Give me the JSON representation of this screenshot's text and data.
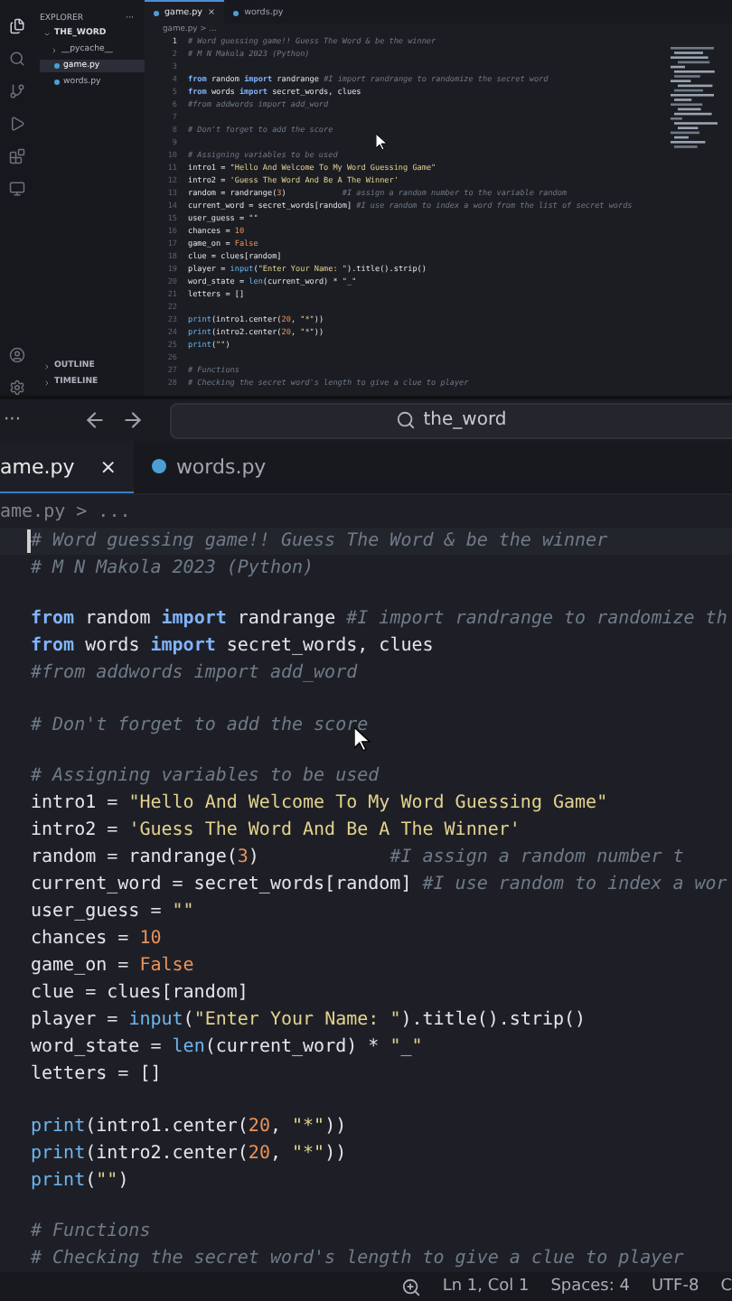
{
  "mini_window": {
    "sidebar": {
      "title": "EXPLORER",
      "more": "···",
      "folder": "THE_WORD",
      "items": [
        {
          "label": "__pycache__",
          "kind": "folder",
          "selected": false
        },
        {
          "label": "game.py",
          "kind": "file",
          "selected": true
        },
        {
          "label": "words.py",
          "kind": "file",
          "selected": false
        }
      ],
      "panels": [
        "OUTLINE",
        "TIMELINE"
      ]
    },
    "tabs": [
      {
        "label": "game.py",
        "selected": true,
        "close": "×"
      },
      {
        "label": "words.py",
        "selected": false
      }
    ],
    "breadcrumb": "game.py > ...",
    "lines": [
      {
        "number": "1",
        "tokens": [
          {
            "kind": "cmt",
            "text": "# Word guessing game!! Guess The Word & be the winner"
          }
        ]
      },
      {
        "number": "2",
        "tokens": [
          {
            "kind": "cmt",
            "text": "# M N Makola 2023 (Python)"
          }
        ]
      },
      {
        "number": "3"
      },
      {
        "number": "4",
        "tokens": [
          {
            "kind": "kw",
            "text": "from"
          },
          {
            "kind": "txt",
            "text": " random "
          },
          {
            "kind": "kw",
            "text": "import"
          },
          {
            "kind": "txt",
            "text": " randrange "
          },
          {
            "kind": "cmt",
            "text": "#I import randrange to randomize the secret word"
          }
        ]
      },
      {
        "number": "5",
        "tokens": [
          {
            "kind": "kw",
            "text": "from"
          },
          {
            "kind": "txt",
            "text": " words "
          },
          {
            "kind": "kw",
            "text": "import"
          },
          {
            "kind": "txt",
            "text": " secret_words, clues"
          }
        ]
      },
      {
        "number": "6",
        "tokens": [
          {
            "kind": "cmt",
            "text": "#from addwords import add_word"
          }
        ]
      },
      {
        "number": "7"
      },
      {
        "number": "8",
        "tokens": [
          {
            "kind": "cmt",
            "text": "# Don't forget to add the score"
          }
        ]
      },
      {
        "number": "9"
      },
      {
        "number": "10",
        "tokens": [
          {
            "kind": "cmt",
            "text": "# Assigning variables to be used"
          }
        ]
      },
      {
        "number": "11",
        "tokens": [
          {
            "kind": "txt",
            "text": "intro1 = "
          },
          {
            "kind": "str",
            "text": "\"Hello And Welcome To My Word Guessing Game\""
          }
        ]
      },
      {
        "number": "12",
        "tokens": [
          {
            "kind": "txt",
            "text": "intro2 = "
          },
          {
            "kind": "str",
            "text": "'Guess The Word And Be A The Winner'"
          }
        ]
      },
      {
        "number": "13",
        "tokens": [
          {
            "kind": "txt",
            "text": "random = randrange("
          },
          {
            "kind": "num",
            "text": "3"
          },
          {
            "kind": "txt",
            "text": ")            "
          },
          {
            "kind": "cmt",
            "text": "#I assign a random number to the variable random"
          }
        ]
      },
      {
        "number": "14",
        "tokens": [
          {
            "kind": "txt",
            "text": "current_word = secret_words[random] "
          },
          {
            "kind": "cmt",
            "text": "#I use random to index a word from the list of secret words"
          }
        ]
      },
      {
        "number": "15",
        "tokens": [
          {
            "kind": "txt",
            "text": "user_guess = "
          },
          {
            "kind": "str",
            "text": "\"\""
          }
        ]
      },
      {
        "number": "16",
        "tokens": [
          {
            "kind": "txt",
            "text": "chances = "
          },
          {
            "kind": "num",
            "text": "10"
          }
        ]
      },
      {
        "number": "17",
        "tokens": [
          {
            "kind": "txt",
            "text": "game_on = "
          },
          {
            "kind": "num",
            "text": "False"
          }
        ]
      },
      {
        "number": "18",
        "tokens": [
          {
            "kind": "txt",
            "text": "clue = clues[random]"
          }
        ]
      },
      {
        "number": "19",
        "tokens": [
          {
            "kind": "txt",
            "text": "player = "
          },
          {
            "kind": "fn",
            "text": "input"
          },
          {
            "kind": "txt",
            "text": "("
          },
          {
            "kind": "str",
            "text": "\"Enter Your Name: \""
          },
          {
            "kind": "txt",
            "text": ").title().strip()"
          }
        ]
      },
      {
        "number": "20",
        "tokens": [
          {
            "kind": "txt",
            "text": "word_state = "
          },
          {
            "kind": "fn",
            "text": "len"
          },
          {
            "kind": "txt",
            "text": "(current_word) * "
          },
          {
            "kind": "str",
            "text": "\"_\""
          }
        ]
      },
      {
        "number": "21",
        "tokens": [
          {
            "kind": "txt",
            "text": "letters = []"
          }
        ]
      },
      {
        "number": "22"
      },
      {
        "number": "23",
        "tokens": [
          {
            "kind": "fn",
            "text": "print"
          },
          {
            "kind": "txt",
            "text": "(intro1.center("
          },
          {
            "kind": "num",
            "text": "20"
          },
          {
            "kind": "txt",
            "text": ", "
          },
          {
            "kind": "str",
            "text": "\"*\""
          },
          {
            "kind": "txt",
            "text": "))"
          }
        ]
      },
      {
        "number": "24",
        "tokens": [
          {
            "kind": "fn",
            "text": "print"
          },
          {
            "kind": "txt",
            "text": "(intro2.center("
          },
          {
            "kind": "num",
            "text": "20"
          },
          {
            "kind": "txt",
            "text": ", "
          },
          {
            "kind": "str",
            "text": "\"*\""
          },
          {
            "kind": "txt",
            "text": "))"
          }
        ]
      },
      {
        "number": "25",
        "tokens": [
          {
            "kind": "fn",
            "text": "print"
          },
          {
            "kind": "txt",
            "text": "("
          },
          {
            "kind": "str",
            "text": "\"\""
          },
          {
            "kind": "txt",
            "text": ")"
          }
        ]
      },
      {
        "number": "26"
      },
      {
        "number": "27",
        "tokens": [
          {
            "kind": "cmt",
            "text": "# Functions"
          }
        ]
      },
      {
        "number": "28",
        "tokens": [
          {
            "kind": "cmt",
            "text": "# Checking the secret word's length to give a clue to player"
          }
        ]
      }
    ]
  },
  "title_bar": {
    "more": "···",
    "search": "the_word"
  },
  "tabs": [
    {
      "label": "ame.py",
      "selected": true,
      "close": "×"
    },
    {
      "label": "words.py",
      "selected": false
    }
  ],
  "breadcrumb": "ame.py > ...",
  "lines": [
    [
      {
        "kind": "cmt",
        "text": "# Word guessing game!! Guess The Word & be the winner"
      }
    ],
    [
      {
        "kind": "cmt",
        "text": "# M N Makola 2023 (Python)"
      }
    ],
    {
      "kind": "blank"
    },
    [
      {
        "kind": "kw",
        "text": "from"
      },
      {
        "kind": "txt",
        "text": " random "
      },
      {
        "kind": "kw",
        "text": "import"
      },
      {
        "kind": "txt",
        "text": " randrange "
      },
      {
        "kind": "cmt",
        "text": "#I import randrange to randomize th"
      }
    ],
    [
      {
        "kind": "kw",
        "text": "from"
      },
      {
        "kind": "txt",
        "text": " words "
      },
      {
        "kind": "kw",
        "text": "import"
      },
      {
        "kind": "txt",
        "text": " secret_words, clues"
      }
    ],
    [
      {
        "kind": "cmt",
        "text": "#from addwords import add_word"
      }
    ],
    {
      "kind": "blank"
    },
    [
      {
        "kind": "cmt",
        "text": "# Don't forget to add the score"
      }
    ],
    {
      "kind": "blank"
    },
    [
      {
        "kind": "cmt",
        "text": "# Assigning variables to be used"
      }
    ],
    [
      {
        "kind": "txt",
        "text": "intro1 = "
      },
      {
        "kind": "str",
        "text": "\"Hello And Welcome To My Word Guessing Game\""
      }
    ],
    [
      {
        "kind": "txt",
        "text": "intro2 = "
      },
      {
        "kind": "str",
        "text": "'Guess The Word And Be A The Winner'"
      }
    ],
    [
      {
        "kind": "txt",
        "text": "random = randrange("
      },
      {
        "kind": "num",
        "text": "3"
      },
      {
        "kind": "txt",
        "text": ")            "
      },
      {
        "kind": "cmt",
        "text": "#I assign a random number t"
      }
    ],
    [
      {
        "kind": "txt",
        "text": "current_word = secret_words[random] "
      },
      {
        "kind": "cmt",
        "text": "#I use random to index a wor"
      }
    ],
    [
      {
        "kind": "txt",
        "text": "user_guess = "
      },
      {
        "kind": "str",
        "text": "\"\""
      }
    ],
    [
      {
        "kind": "txt",
        "text": "chances = "
      },
      {
        "kind": "num",
        "text": "10"
      }
    ],
    [
      {
        "kind": "txt",
        "text": "game_on = "
      },
      {
        "kind": "num",
        "text": "False"
      }
    ],
    [
      {
        "kind": "txt",
        "text": "clue = clues[random]"
      }
    ],
    [
      {
        "kind": "txt",
        "text": "player = "
      },
      {
        "kind": "fn",
        "text": "input"
      },
      {
        "kind": "txt",
        "text": "("
      },
      {
        "kind": "str",
        "text": "\"Enter Your Name: \""
      },
      {
        "kind": "txt",
        "text": ").title().strip()"
      }
    ],
    [
      {
        "kind": "txt",
        "text": "word_state = "
      },
      {
        "kind": "fn",
        "text": "len"
      },
      {
        "kind": "txt",
        "text": "(current_word) * "
      },
      {
        "kind": "str",
        "text": "\"_\""
      }
    ],
    [
      {
        "kind": "txt",
        "text": "letters = []"
      }
    ],
    {
      "kind": "blank"
    },
    [
      {
        "kind": "fn",
        "text": "print"
      },
      {
        "kind": "txt",
        "text": "(intro1.center("
      },
      {
        "kind": "num",
        "text": "20"
      },
      {
        "kind": "txt",
        "text": ", "
      },
      {
        "kind": "str",
        "text": "\"*\""
      },
      {
        "kind": "txt",
        "text": "))"
      }
    ],
    [
      {
        "kind": "fn",
        "text": "print"
      },
      {
        "kind": "txt",
        "text": "(intro2.center("
      },
      {
        "kind": "num",
        "text": "20"
      },
      {
        "kind": "txt",
        "text": ", "
      },
      {
        "kind": "str",
        "text": "\"*\""
      },
      {
        "kind": "txt",
        "text": "))"
      }
    ],
    [
      {
        "kind": "fn",
        "text": "print"
      },
      {
        "kind": "txt",
        "text": "("
      },
      {
        "kind": "str",
        "text": "\"\""
      },
      {
        "kind": "txt",
        "text": ")"
      }
    ],
    {
      "kind": "blank"
    },
    [
      {
        "kind": "cmt",
        "text": "# Functions"
      }
    ],
    [
      {
        "kind": "cmt",
        "text": "# Checking the secret word's length to give a clue to player"
      }
    ]
  ],
  "status_bar": {
    "items": [
      "Ln 1, Col 1",
      "Spaces: 4",
      "UTF-8",
      "C"
    ]
  }
}
